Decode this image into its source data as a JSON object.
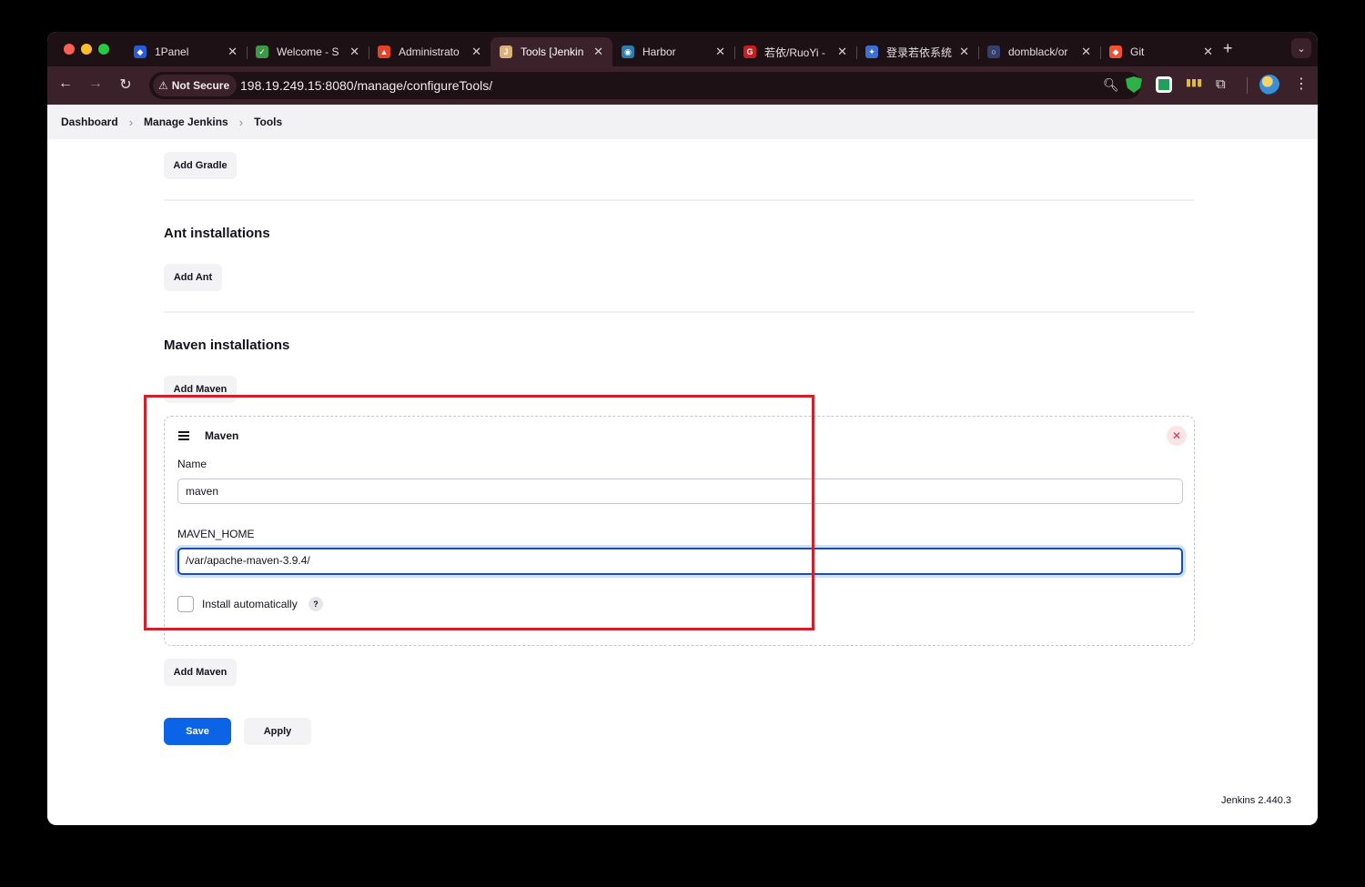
{
  "browser": {
    "tabs": [
      {
        "title": "1Panel",
        "icon": "1panel-icon",
        "color": "#2a5bd7",
        "glyph": "◆"
      },
      {
        "title": "Welcome - S",
        "icon": "sonarqube-icon",
        "color": "#3c9a44",
        "glyph": "✓"
      },
      {
        "title": "Administrato",
        "icon": "gitlab-icon",
        "color": "#e24329",
        "glyph": "▲"
      },
      {
        "title": "Tools [Jenkin",
        "icon": "jenkins-icon",
        "color": "#d9b27a",
        "glyph": "J"
      },
      {
        "title": "Harbor",
        "icon": "harbor-icon",
        "color": "#2f7dab",
        "glyph": "◉"
      },
      {
        "title": "若依/RuoYi -",
        "icon": "gitee-icon",
        "color": "#c71d23",
        "glyph": "G"
      },
      {
        "title": "登录若依系统",
        "icon": "ruoyi-icon",
        "color": "#3b6fd1",
        "glyph": "✦"
      },
      {
        "title": "domblack/or",
        "icon": "github-icon",
        "color": "#343f6e",
        "glyph": "○"
      },
      {
        "title": "Git",
        "icon": "git-icon",
        "color": "#f05133",
        "glyph": "◆"
      }
    ],
    "active_tab": 3,
    "security_label": "Not Secure",
    "url": "198.19.249.15:8080/manage/configureTools/"
  },
  "breadcrumb": {
    "items": [
      "Dashboard",
      "Manage Jenkins",
      "Tools"
    ]
  },
  "gradle": {
    "add_label": "Add Gradle"
  },
  "ant": {
    "title": "Ant installations",
    "add_label": "Add Ant"
  },
  "maven": {
    "title": "Maven installations",
    "add_label_top": "Add Maven",
    "item": {
      "header": "Maven",
      "name_label": "Name",
      "name_value": "maven",
      "home_label": "MAVEN_HOME",
      "home_value": "/var/apache-maven-3.9.4/",
      "install_auto_label": "Install automatically",
      "install_auto_checked": false,
      "help_glyph": "?",
      "delete_glyph": "✕"
    },
    "add_label_bottom": "Add Maven"
  },
  "actions": {
    "save_label": "Save",
    "apply_label": "Apply"
  },
  "footer": {
    "version": "Jenkins 2.440.3"
  },
  "colors": {
    "highlight": "#d0202c",
    "primary": "#0b63e5"
  }
}
